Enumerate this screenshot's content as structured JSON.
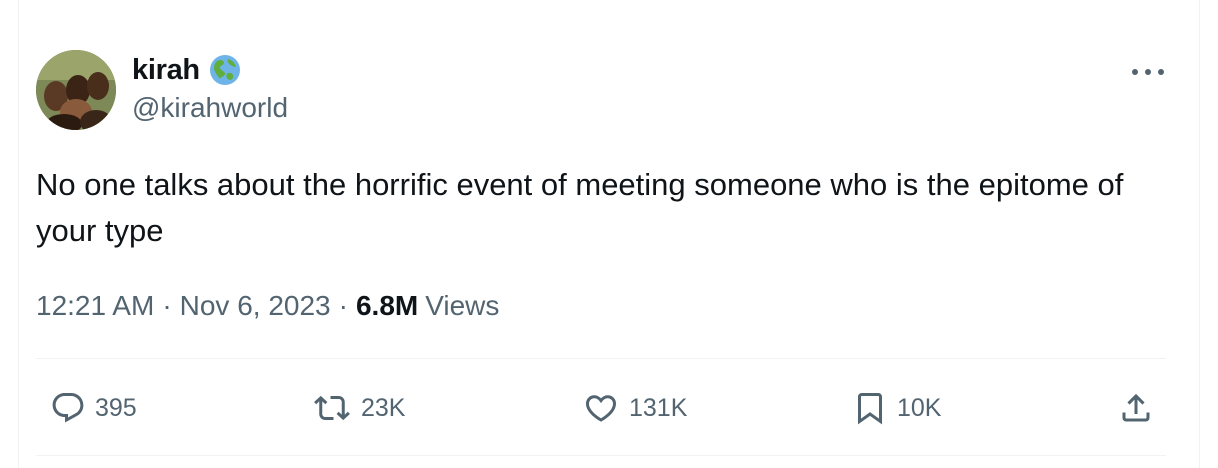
{
  "author": {
    "display_name": "kirah",
    "handle": "@kirahworld",
    "badge_icon": "globe-americas-icon",
    "avatar_icon": "profile-photo"
  },
  "tweet": {
    "text": "No one talks about the horrific event of meeting someone who is the epitome of your type",
    "time": "12:21 AM",
    "separator": "·",
    "date": "Nov 6, 2023",
    "views_count": "6.8M",
    "views_label": "Views"
  },
  "actions": {
    "reply": {
      "icon": "reply-icon",
      "count": "395"
    },
    "retweet": {
      "icon": "retweet-icon",
      "count": "23K"
    },
    "like": {
      "icon": "heart-icon",
      "count": "131K"
    },
    "bookmark": {
      "icon": "bookmark-icon",
      "count": "10K"
    },
    "share": {
      "icon": "share-icon"
    }
  },
  "colors": {
    "text_primary": "#0f1419",
    "text_secondary": "#536471",
    "divider": "#eff3f4"
  }
}
